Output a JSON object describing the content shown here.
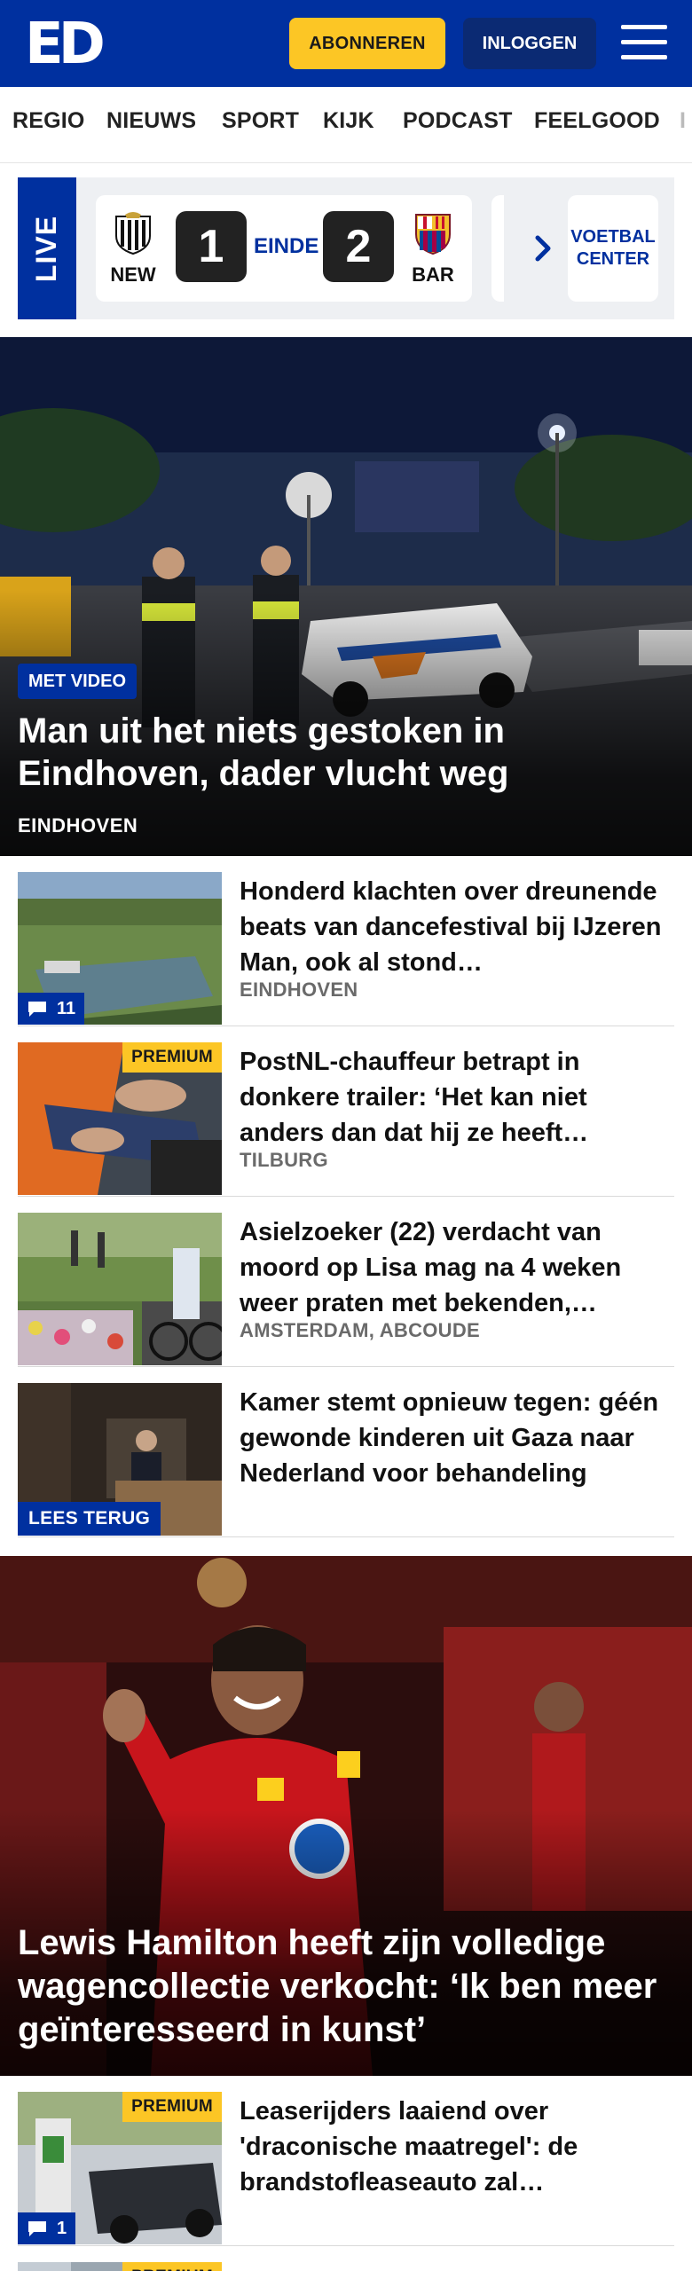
{
  "header": {
    "logo": "ED",
    "subscribe_label": "ABONNEREN",
    "login_label": "INLOGGEN"
  },
  "nav": {
    "items": [
      "REGIO",
      "NIEUWS",
      "SPORT",
      "KIJK",
      "PODCAST",
      "FEELGOOD",
      "I"
    ]
  },
  "live": {
    "tab_label": "LIVE",
    "match": {
      "home_code": "NEW",
      "away_code": "BAR",
      "home_score": "1",
      "away_score": "2",
      "status": "EINDE"
    },
    "voetbal_center": "VOETBAL CENTER"
  },
  "hero": {
    "badge": "MET VIDEO",
    "title": "Man uit het niets gestoken in Eindhoven, dader vlucht weg",
    "location": "EINDHOVEN"
  },
  "articles": [
    {
      "title": "Honderd klachten over dreunende beats van dancefesti­val bij IJzeren Man, ook al stond…",
      "location": "EINDHOVEN",
      "comments": "11"
    },
    {
      "title": "PostNL-chauffeur betrapt in donkere trailer: ‘Het kan niet anders dan dat hij ze heeft…",
      "location": "TILBURG",
      "premium": "PREMIUM"
    },
    {
      "title": "Asielzoeker (22) verdacht van moord op Lisa mag na 4 weken weer praten met bekenden,…",
      "location": "AMSTERDAM, ABCOUDE"
    },
    {
      "title": "Kamer stemt opnieuw tegen: géén gewonde kinderen uit Gaza naar Nederland voor behandeling",
      "tag": "LEES TERUG"
    }
  ],
  "hero2": {
    "title": "Lewis Hamilton heeft zijn volledige wagencollectie verkocht: ‘Ik ben meer geïnteresseerd in kunst’"
  },
  "articles2": [
    {
      "title": "Leaserijders laaiend over 'draconische maatregel': de brandstofleaseauto zal…",
      "premium": "PREMIUM",
      "comments": "1"
    },
    {
      "premium": "PREMIUM"
    }
  ],
  "colors": {
    "brand_blue": "#00309f",
    "accent_yellow": "#fcc625",
    "login_blue": "#0b2a73"
  }
}
